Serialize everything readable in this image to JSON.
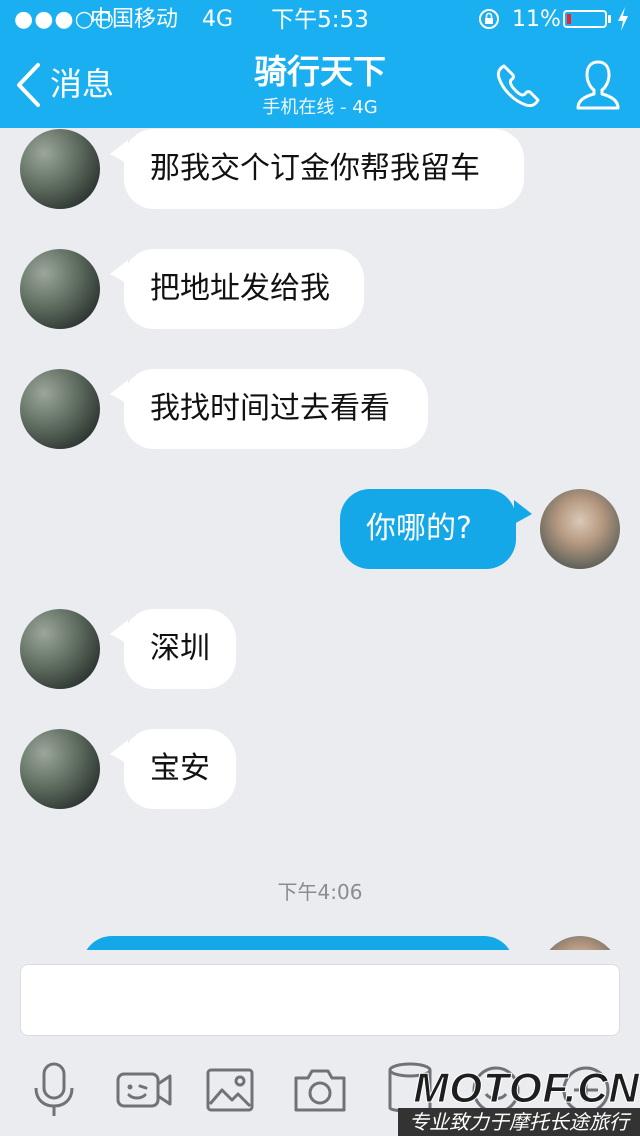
{
  "status_bar": {
    "signal": "●●●○○",
    "carrier": "中国移动",
    "network": "4G",
    "time": "下午5:53",
    "battery_percent": "11%",
    "battery_level": 0.11,
    "battery_color": "#e9262c"
  },
  "nav": {
    "back_label": "消息",
    "title": "骑行天下",
    "subtitle": "手机在线 - 4G"
  },
  "messages": [
    {
      "direction": "in",
      "text": "那我交个订金你帮我留车"
    },
    {
      "direction": "in",
      "text": "把地址发给我"
    },
    {
      "direction": "in",
      "text": "我找时间过去看看"
    },
    {
      "direction": "out",
      "text": "你哪的?"
    },
    {
      "direction": "in",
      "text": "深圳"
    },
    {
      "direction": "in",
      "text": "宝安"
    }
  ],
  "timestamp": "下午4:06",
  "input": {
    "value": "",
    "placeholder": ""
  },
  "toolbar": {
    "icons": [
      "microphone-icon",
      "video-icon",
      "image-icon",
      "camera-icon",
      "file-icon",
      "emoji-icon",
      "plus-icon"
    ]
  },
  "watermark": {
    "brand": "MOTOF.CN",
    "tagline": "专业致力于摩托长途旅行"
  },
  "colors": {
    "header": "#1aaff0",
    "outgoing_bubble": "#14a8e8",
    "incoming_bubble": "#ffffff",
    "background": "#ebecf0"
  }
}
